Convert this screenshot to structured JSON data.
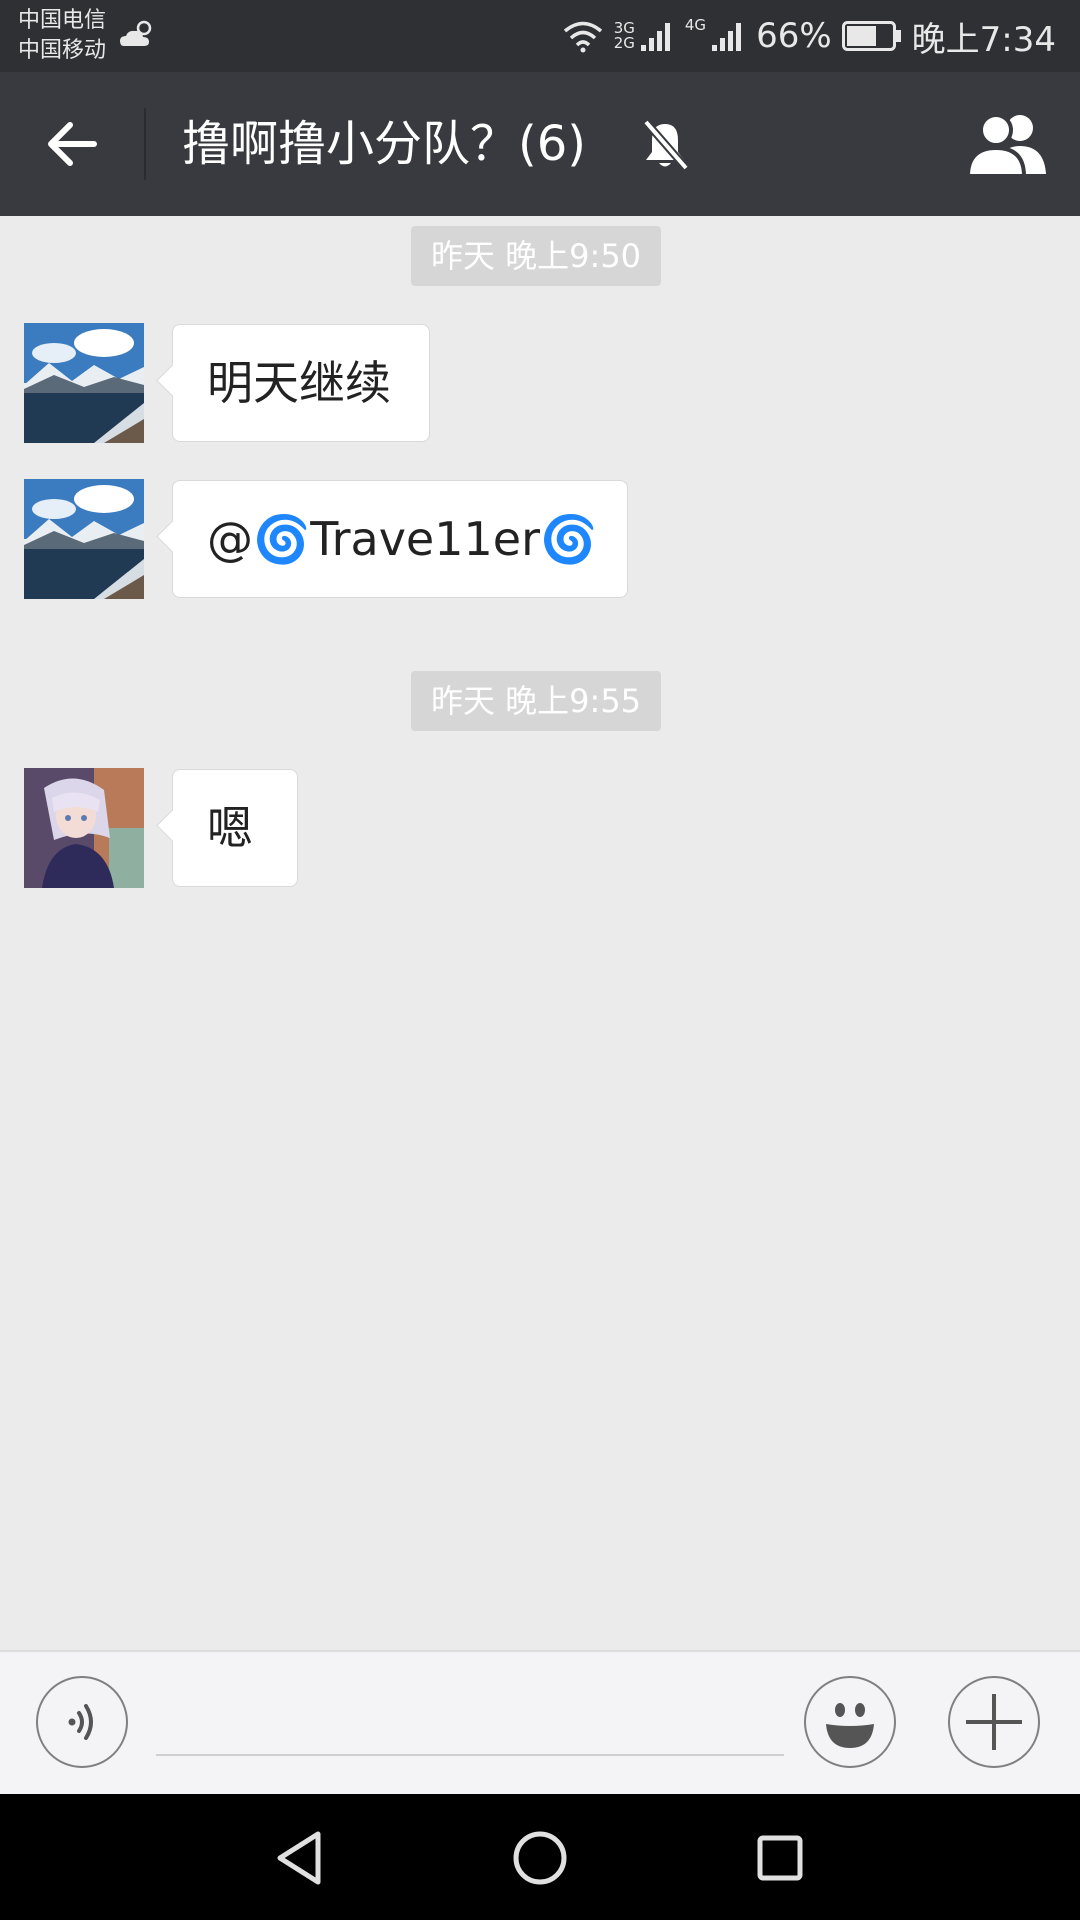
{
  "status_bar": {
    "carrier_1": "中国电信",
    "carrier_2": "中国移动",
    "weather_icon": "partly-cloudy-icon",
    "wifi_icon": "wifi-icon",
    "signal_1_tag_top": "3G",
    "signal_1_tag_bottom": "2G",
    "signal_2_tag": "4G",
    "battery_percent": "66%",
    "battery_level": 0.66,
    "time": "晚上7:34"
  },
  "header": {
    "title": "撸啊撸小分队？(6)",
    "back_icon": "arrow-left-icon",
    "mute_icon": "bell-off-icon",
    "members_icon": "group-icon"
  },
  "messages": [
    {
      "type": "timestamp",
      "text": "昨天 晚上9:50"
    },
    {
      "type": "text",
      "avatar": "landscape-avatar",
      "text": "明天继续"
    },
    {
      "type": "text",
      "avatar": "landscape-avatar",
      "text": "@🌀Trave11er🌀"
    },
    {
      "type": "timestamp",
      "text": "昨天 晚上9:55"
    },
    {
      "type": "text",
      "avatar": "anime-avatar",
      "text": "嗯"
    }
  ],
  "input_bar": {
    "voice_icon": "voice-icon",
    "input_value": "",
    "emoji_icon": "smiley-icon",
    "plus_icon": "plus-icon"
  },
  "nav_bar": {
    "back_icon": "triangle-back-icon",
    "home_icon": "circle-home-icon",
    "recents_icon": "square-recents-icon"
  },
  "colors": {
    "status_bar_bg": "#2f3034",
    "title_bar_bg": "#393a3f",
    "chat_bg": "#ebebeb",
    "bubble_bg": "#ffffff",
    "timestamp_bg": "#d6d6d6"
  }
}
